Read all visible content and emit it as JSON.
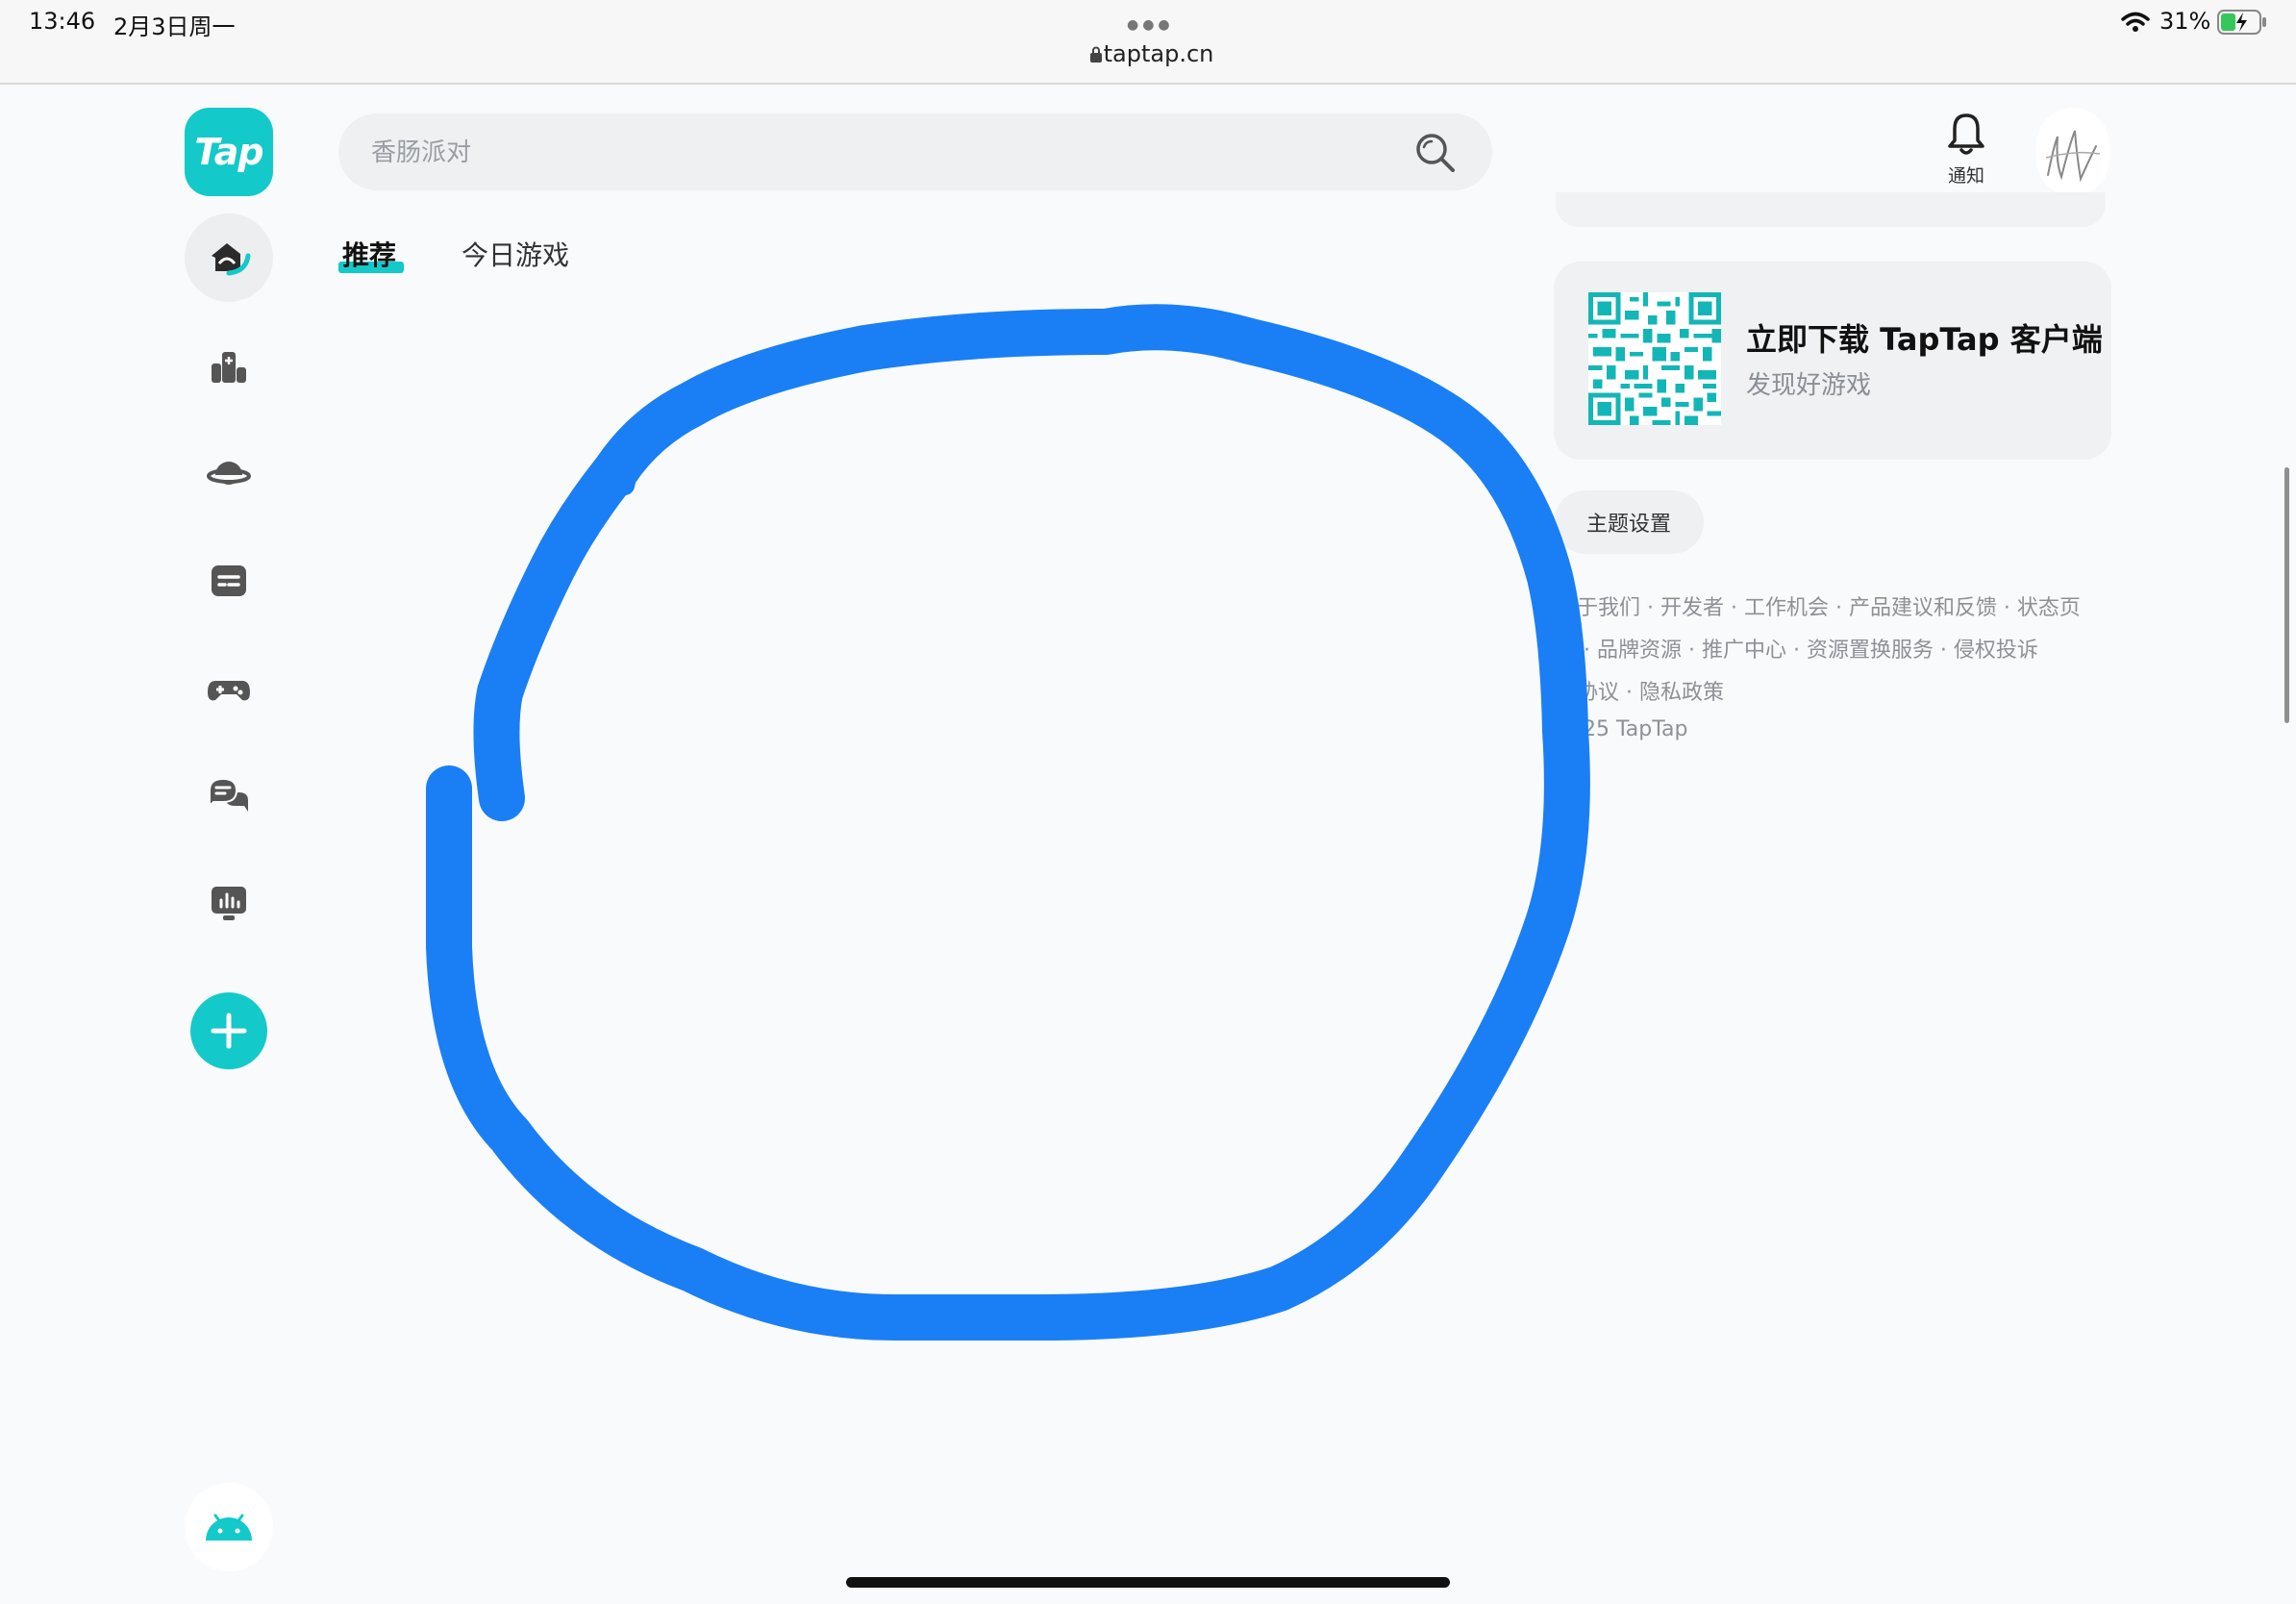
{
  "status_bar": {
    "time": "13:46",
    "date": "2月3日周一",
    "url": "taptap.cn",
    "battery": "31%"
  },
  "sidebar": {
    "logo_text": "Tap",
    "items": [
      {
        "icon": "home-icon",
        "active": true
      },
      {
        "icon": "ranking-icon"
      },
      {
        "icon": "planet-icon"
      },
      {
        "icon": "feed-icon"
      },
      {
        "icon": "gamepad-icon"
      },
      {
        "icon": "chat-icon"
      },
      {
        "icon": "stats-icon"
      }
    ],
    "add_icon": "plus-icon",
    "bottom_icon": "android-icon"
  },
  "search": {
    "placeholder": "香肠派对"
  },
  "tabs": [
    {
      "label": "推荐",
      "active": true
    },
    {
      "label": "今日游戏",
      "active": false
    }
  ],
  "header_right": {
    "notification_label": "通知"
  },
  "download_card": {
    "title": "立即下载 TapTap 客户端",
    "subtitle": "发现好游戏"
  },
  "theme_button": "主题设置",
  "footer": {
    "line1": "关于我们 · 开发者 · 工作机会 · 产品建议和反馈 · 状态页",
    "line2": "证 · 品牌资源 · 推广中心 · 资源置换服务 · 侵权投诉",
    "line3": "务协议 · 隐私政策",
    "copyright": "2025 TapTap"
  },
  "colors": {
    "brand": "#14c9c9",
    "annotation": "#1a7ff5",
    "background": "#f9fafb"
  }
}
